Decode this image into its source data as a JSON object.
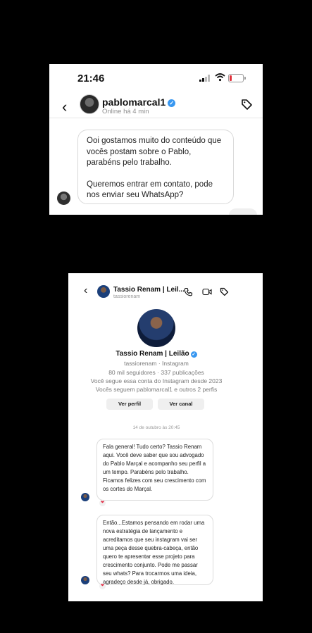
{
  "screenshot_top": {
    "status_time": "21:46",
    "username": "pablomarcal1",
    "status_line": "Online há 4 min",
    "message_paragraphs": [
      "Ooi gostamos muito do conteúdo que vocês postam sobre o Pablo, parabéns pelo trabalho.",
      "Queremos entrar em contato, pode nos enviar seu WhatsApp?"
    ]
  },
  "screenshot_bottom": {
    "header_name": "Tassio Renam | Leil...",
    "header_username": "tassiorenam",
    "profile": {
      "name": "Tassio Renam | Leilão",
      "handle_line": "tassiorenam · Instagram",
      "stats_line": "80 mil seguidores · 337 publicações",
      "since_line": "Você segue essa conta do Instagram desde 2023",
      "mutual_line": "Vocês seguem pablomarcal1 e outros 2 perfis",
      "btn_profile": "Ver perfil",
      "btn_channel": "Ver canal"
    },
    "date_divider": "14 de outubro às 20:45",
    "messages": [
      "Fala general! Tudo certo? Tassio Renam aqui. Você deve saber que sou advogado do Pablo Marçal e acompanho seu perfil a um tempo. Parabéns pelo trabalho. Ficamos felizes com seu crescimento com os cortes do Marçal.",
      "Então...Estamos pensando em rodar uma nova estratégia de lançamento e acreditamos que seu instagram vai ser uma peça desse quebra-cabeça, então quero te apresentar esse projeto para crescimento conjunto. Pode me passar seu whats? Para trocarmos uma ideia, agradeço desde já, obrigado."
    ]
  },
  "colors": {
    "verified": "#3897f0",
    "battery_low": "#e0303a",
    "heart": "#e3334b"
  },
  "icons": [
    "back-arrow-icon",
    "verified-badge-icon",
    "tag-icon",
    "phone-icon",
    "video-icon",
    "heart-icon",
    "signal-icon",
    "wifi-icon",
    "battery-icon"
  ]
}
